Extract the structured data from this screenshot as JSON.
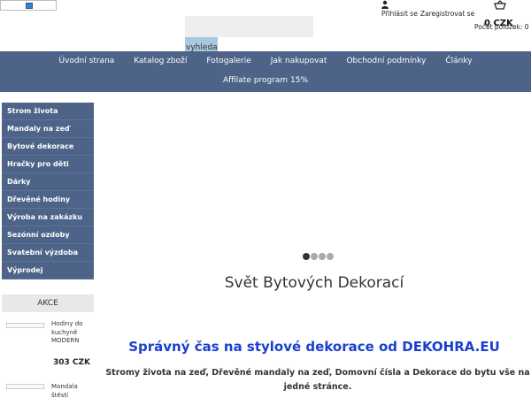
{
  "header": {
    "search": {
      "placeholder": "",
      "button_label": "vyhledat"
    },
    "login_label": "Přihlásit se",
    "register_label": "Zaregistrovat se",
    "cart": {
      "total": "0 CZK",
      "count_label": "Počet položek: 0"
    }
  },
  "nav": {
    "row1": [
      "Úvodní strana",
      "Katalog zboží",
      "Fotogalerie",
      "Jak nakupovat",
      "Obchodní podmínky",
      "Články"
    ],
    "row2": [
      "Affilate program 15%"
    ]
  },
  "sidebar": {
    "items": [
      "Strom života",
      "Mandaly na zeď",
      "Bytové dekorace",
      "Hračky pro děti",
      "Dárky",
      "Dřevěné hodiny",
      "Výroba na zakázku",
      "Sezónní ozdoby",
      "Svatební výzdoba",
      "Výprodej"
    ]
  },
  "akce": {
    "title": "AKCE",
    "products": [
      {
        "name": "Hodiny do kuchyně MODERN",
        "price": "303 CZK"
      },
      {
        "name": "Mandala štěstí KRUHY",
        "price": ""
      }
    ]
  },
  "main": {
    "slider": {
      "dots": 4,
      "active": 0
    },
    "slide_title": "Svět Bytových Dekorací",
    "headline": "Správný čas na stylové dekorace od DEKOHRA.EU",
    "subtext": "Stromy života na zeď, Dřevěné mandaly na zeď, Domovní čísla a Dekorace do bytu vše na jedné stránce."
  },
  "colors": {
    "nav_bg": "#4d6388",
    "headline": "#1a3fd1",
    "search_button": "#a8c8e0"
  }
}
